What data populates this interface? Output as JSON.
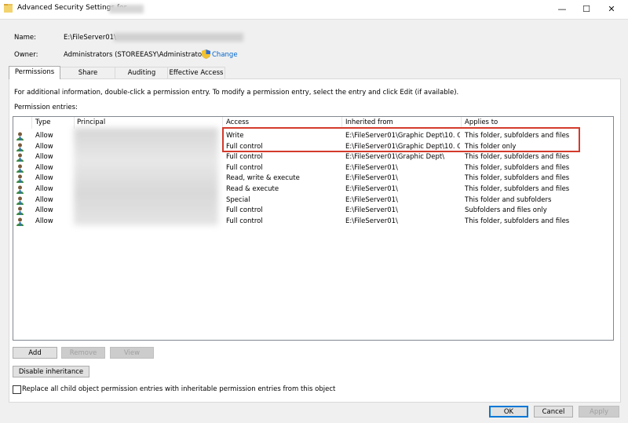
{
  "window": {
    "title": "Advanced Security Settings for",
    "minimize": "—",
    "maximize": "☐",
    "close": "✕"
  },
  "name_label": "Name:",
  "name_value": "E:\\FileServer01\\",
  "owner_label": "Owner:",
  "owner_value": "Administrators (STOREEASY\\Administrators)",
  "change_link": "Change",
  "tabs": [
    "Permissions",
    "Share",
    "Auditing",
    "Effective Access"
  ],
  "info_text": "For additional information, double-click a permission entry. To modify a permission entry, select the entry and click Edit (if available).",
  "entries_label": "Permission entries:",
  "columns": [
    "Type",
    "Principal",
    "Access",
    "Inherited from",
    "Applies to"
  ],
  "rows": [
    {
      "type": "Allow",
      "access": "Write",
      "inherited": "E:\\FileServer01\\Graphic Dept\\10. Gr...",
      "applies": "This folder, subfolders and files"
    },
    {
      "type": "Allow",
      "access": "Full control",
      "inherited": "E:\\FileServer01\\Graphic Dept\\10. Gr...",
      "applies": "This folder only"
    },
    {
      "type": "Allow",
      "access": "Full control",
      "inherited": "E:\\FileServer01\\Graphic Dept\\",
      "applies": "This folder, subfolders and files"
    },
    {
      "type": "Allow",
      "access": "Full control",
      "inherited": "E:\\FileServer01\\",
      "applies": "This folder, subfolders and files"
    },
    {
      "type": "Allow",
      "access": "Read, write & execute",
      "inherited": "E:\\FileServer01\\",
      "applies": "This folder, subfolders and files"
    },
    {
      "type": "Allow",
      "access": "Read & execute",
      "inherited": "E:\\FileServer01\\",
      "applies": "This folder, subfolders and files"
    },
    {
      "type": "Allow",
      "access": "Special",
      "inherited": "E:\\FileServer01\\",
      "applies": "This folder and subfolders"
    },
    {
      "type": "Allow",
      "access": "Full control",
      "inherited": "E:\\FileServer01\\",
      "applies": "Subfolders and files only"
    },
    {
      "type": "Allow",
      "access": "Full control",
      "inherited": "E:\\FileServer01\\",
      "applies": "This folder, subfolders and files"
    }
  ],
  "buttons": {
    "add": "Add",
    "remove": "Remove",
    "view": "View",
    "disable_inheritance": "Disable inheritance",
    "ok": "OK",
    "cancel": "Cancel",
    "apply": "Apply"
  },
  "replace_checkbox_label": "Replace all child object permission entries with inheritable permission entries from this object",
  "replace_checkbox_checked": false,
  "colors": {
    "highlight_border": "#d33a2c",
    "link": "#0066cc",
    "default_button_border": "#0078d7"
  },
  "icons": {
    "title": "folder-icon",
    "owner_change": "uac-shield-icon",
    "row": "user-icon"
  }
}
